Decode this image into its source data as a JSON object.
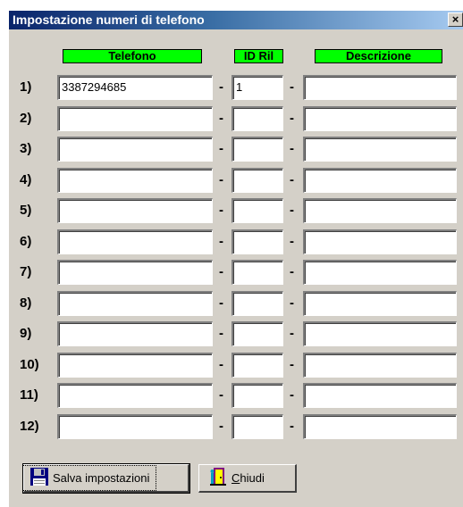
{
  "window": {
    "title": "Impostazione numeri di telefono",
    "close_glyph": "×"
  },
  "headers": {
    "telefono": "Telefono",
    "id_ril": "ID Ril",
    "descrizione": "Descrizione"
  },
  "separator": "-",
  "rows": [
    {
      "label": "1)",
      "telefono": "3387294685",
      "id_ril": "1",
      "descrizione": ""
    },
    {
      "label": "2)",
      "telefono": "",
      "id_ril": "",
      "descrizione": ""
    },
    {
      "label": "3)",
      "telefono": "",
      "id_ril": "",
      "descrizione": ""
    },
    {
      "label": "4)",
      "telefono": "",
      "id_ril": "",
      "descrizione": ""
    },
    {
      "label": "5)",
      "telefono": "",
      "id_ril": "",
      "descrizione": ""
    },
    {
      "label": "6)",
      "telefono": "",
      "id_ril": "",
      "descrizione": ""
    },
    {
      "label": "7)",
      "telefono": "",
      "id_ril": "",
      "descrizione": ""
    },
    {
      "label": "8)",
      "telefono": "",
      "id_ril": "",
      "descrizione": ""
    },
    {
      "label": "9)",
      "telefono": "",
      "id_ril": "",
      "descrizione": ""
    },
    {
      "label": "10)",
      "telefono": "",
      "id_ril": "",
      "descrizione": ""
    },
    {
      "label": "11)",
      "telefono": "",
      "id_ril": "",
      "descrizione": ""
    },
    {
      "label": "12)",
      "telefono": "",
      "id_ril": "",
      "descrizione": ""
    }
  ],
  "buttons": {
    "save": {
      "label": "Salva impostazioni",
      "icon": "floppy-disk-icon"
    },
    "close": {
      "label_mnemonic": "C",
      "label_rest": "hiudi",
      "icon": "exit-door-icon"
    }
  },
  "colors": {
    "header_bg": "#00ff00",
    "titlebar_start": "#0a246a",
    "titlebar_end": "#a6caf0"
  }
}
